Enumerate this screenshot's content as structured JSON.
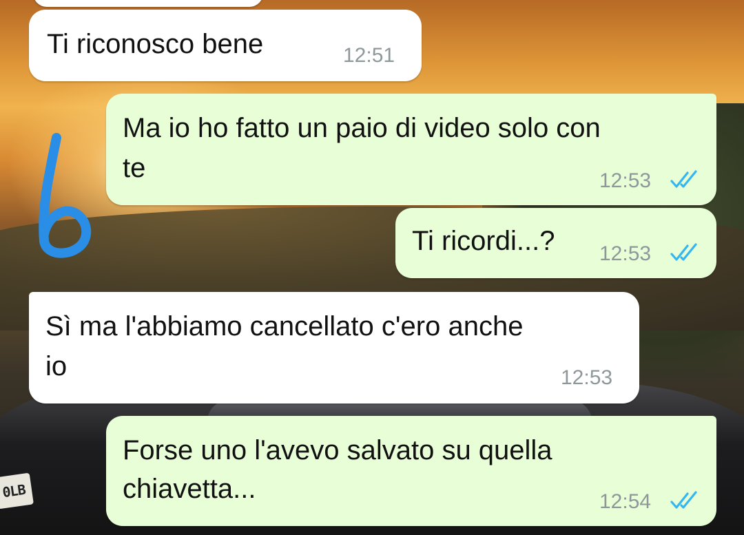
{
  "colors": {
    "incoming_bubble": "#ffffff",
    "outgoing_bubble": "#e7fed7",
    "timestamp": "#8e979a",
    "read_ticks": "#34b7f1",
    "annotation_ink": "#2a8ee6"
  },
  "wallpaper": {
    "plate_text": "0LB"
  },
  "annotation": {
    "glyph": "6"
  },
  "messages": [
    {
      "direction": "incoming",
      "lines": [
        "Ti riconosco bene"
      ],
      "time": "12:51"
    },
    {
      "direction": "outgoing",
      "lines": [
        "Ma io ho fatto un paio di video solo con",
        "te"
      ],
      "time": "12:53",
      "status_icon": "double-check-read-icon"
    },
    {
      "direction": "outgoing",
      "lines": [
        "Ti ricordi...?"
      ],
      "time": "12:53",
      "status_icon": "double-check-read-icon"
    },
    {
      "direction": "incoming",
      "lines": [
        "Sì ma l'abbiamo cancellato c'ero anche",
        "io"
      ],
      "time": "12:53"
    },
    {
      "direction": "outgoing",
      "lines": [
        "Forse uno l'avevo salvato su quella",
        "chiavetta..."
      ],
      "time": "12:54",
      "status_icon": "double-check-read-icon"
    }
  ]
}
